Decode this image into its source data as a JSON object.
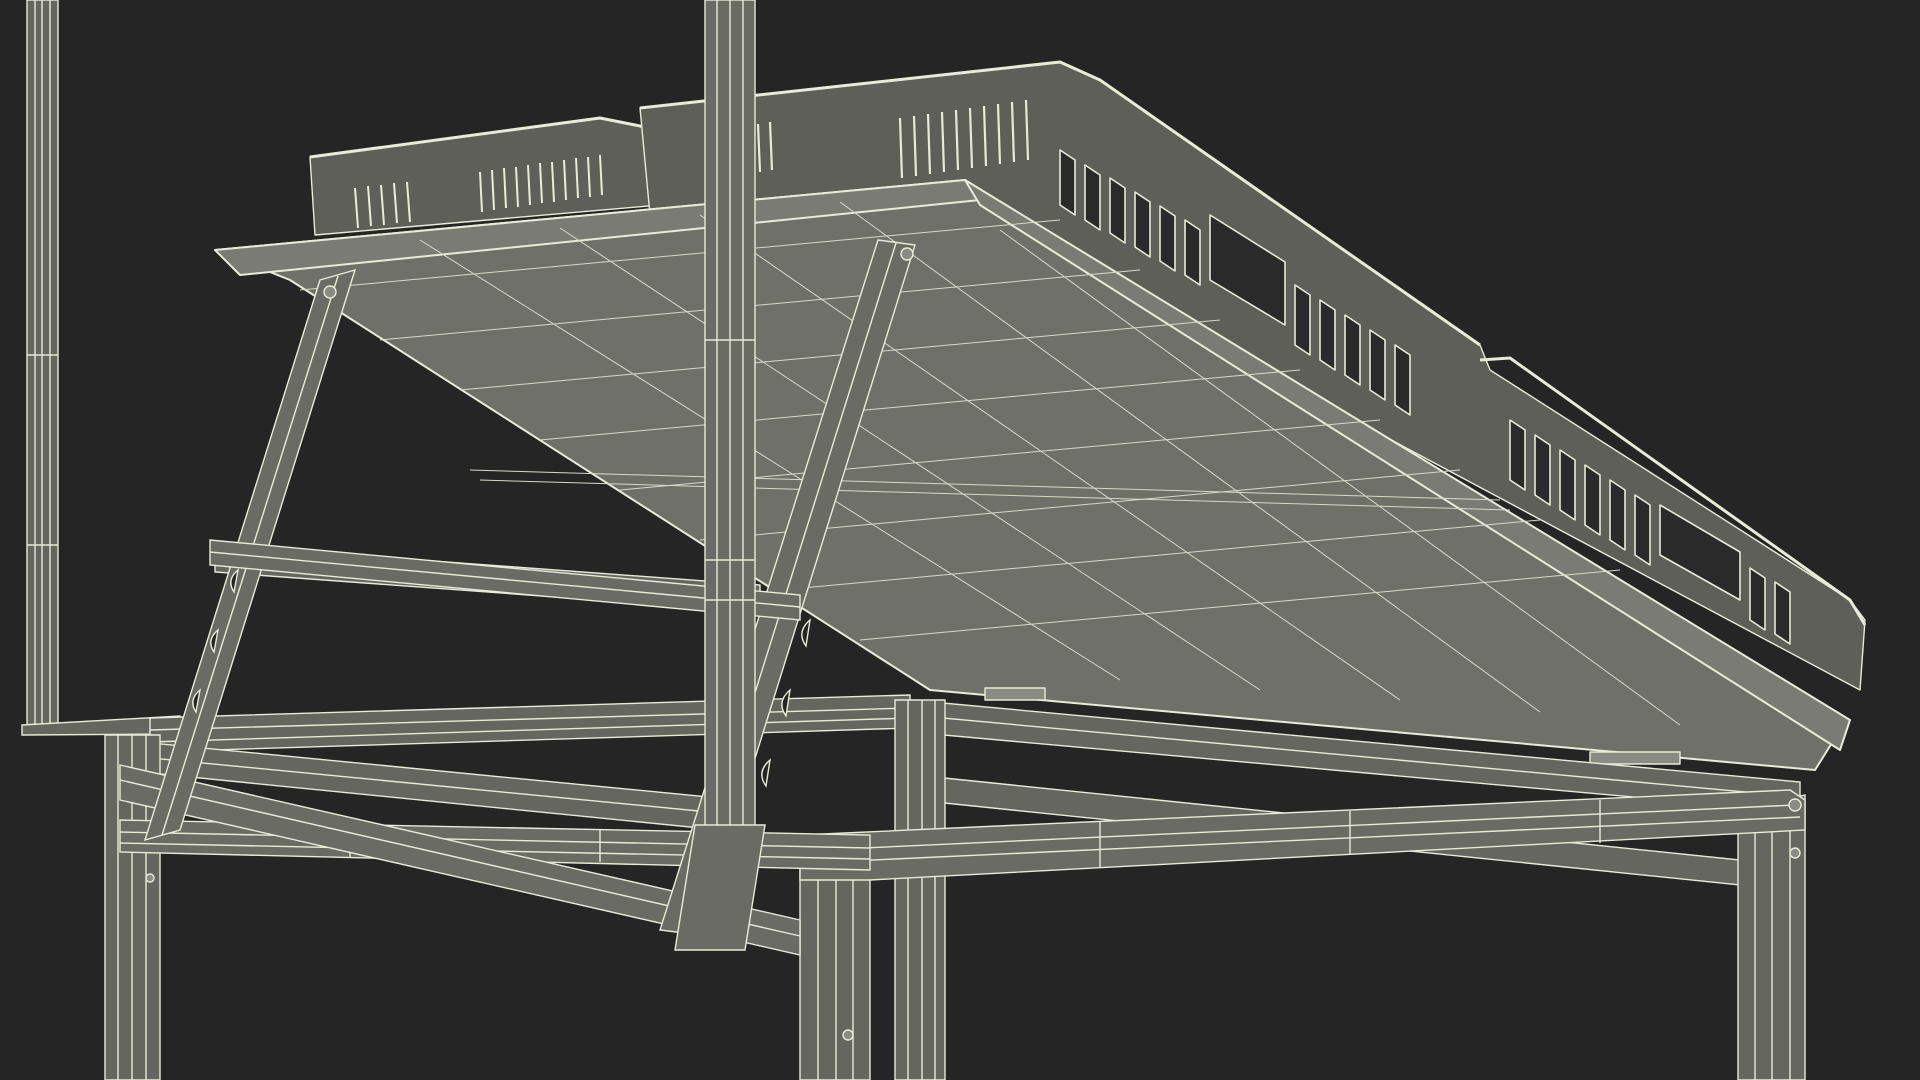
{
  "scene": {
    "subject": "wireframe-render",
    "colors": {
      "background": "#252525",
      "panel_fill": "#6f706a",
      "frame_fill": "#65665f",
      "basket_fill": "#5e5f59",
      "wire": "#e9ead8",
      "wire_dim": "#c8c9b8",
      "hole": "#2a2a2a"
    }
  }
}
